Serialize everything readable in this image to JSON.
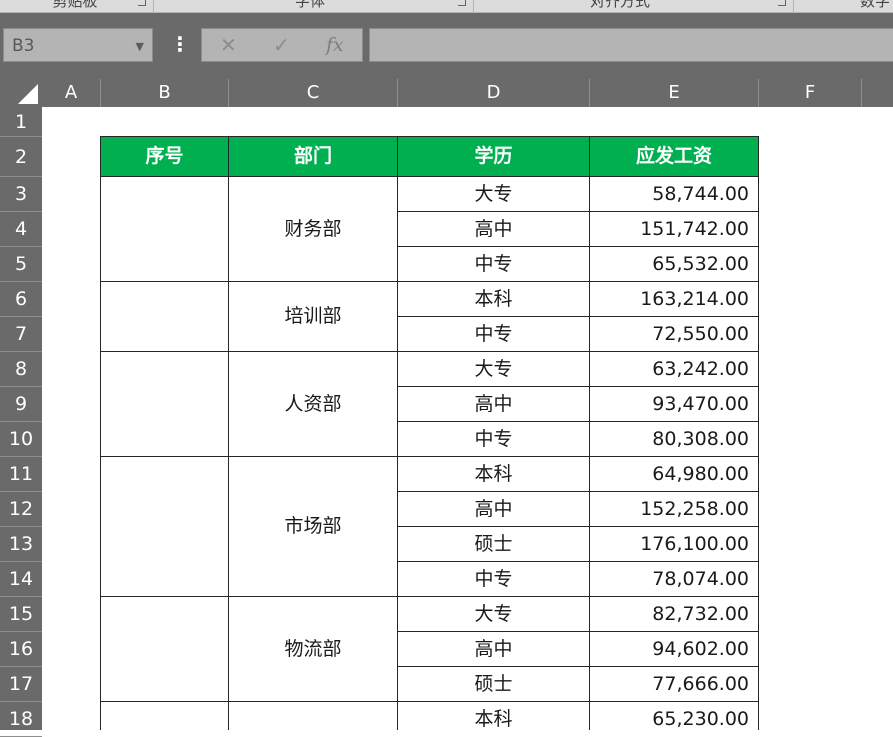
{
  "ribbon": {
    "groups": [
      "剪贴板",
      "字体",
      "对齐方式",
      "数字"
    ]
  },
  "formula_bar": {
    "name_box": "B3",
    "name_box_dropdown_icon": "chevron-down-icon",
    "more_icon": "vertical-ellipsis-icon",
    "cancel_icon": "✕",
    "enter_icon": "✓",
    "fx_label": "fx",
    "formula_value": ""
  },
  "columns": [
    "A",
    "B",
    "C",
    "D",
    "E",
    "F"
  ],
  "rows": [
    "1",
    "2",
    "3",
    "4",
    "5",
    "6",
    "7",
    "8",
    "9",
    "10",
    "11",
    "12",
    "13",
    "14",
    "15",
    "16",
    "17",
    "18"
  ],
  "table": {
    "headers": [
      "序号",
      "部门",
      "学历",
      "应发工资"
    ],
    "groups": [
      {
        "seq": "",
        "dept": "财务部",
        "rows": [
          {
            "edu": "大专",
            "pay": "58,744.00"
          },
          {
            "edu": "高中",
            "pay": "151,742.00"
          },
          {
            "edu": "中专",
            "pay": "65,532.00"
          }
        ]
      },
      {
        "seq": "",
        "dept": "培训部",
        "rows": [
          {
            "edu": "本科",
            "pay": "163,214.00"
          },
          {
            "edu": "中专",
            "pay": "72,550.00"
          }
        ]
      },
      {
        "seq": "",
        "dept": "人资部",
        "rows": [
          {
            "edu": "大专",
            "pay": "63,242.00"
          },
          {
            "edu": "高中",
            "pay": "93,470.00"
          },
          {
            "edu": "中专",
            "pay": "80,308.00"
          }
        ]
      },
      {
        "seq": "",
        "dept": "市场部",
        "rows": [
          {
            "edu": "本科",
            "pay": "64,980.00"
          },
          {
            "edu": "高中",
            "pay": "152,258.00"
          },
          {
            "edu": "硕士",
            "pay": "176,100.00"
          },
          {
            "edu": "中专",
            "pay": "78,074.00"
          }
        ]
      },
      {
        "seq": "",
        "dept": "物流部",
        "rows": [
          {
            "edu": "大专",
            "pay": "82,732.00"
          },
          {
            "edu": "高中",
            "pay": "94,602.00"
          },
          {
            "edu": "硕士",
            "pay": "77,666.00"
          }
        ]
      },
      {
        "seq": "",
        "dept": "",
        "rows": [
          {
            "edu": "本科",
            "pay": "65,230.00"
          }
        ]
      }
    ]
  },
  "colors": {
    "header_fill": "#00b050",
    "header_text": "#ffffff",
    "chrome_bg": "#6a6a6a"
  }
}
